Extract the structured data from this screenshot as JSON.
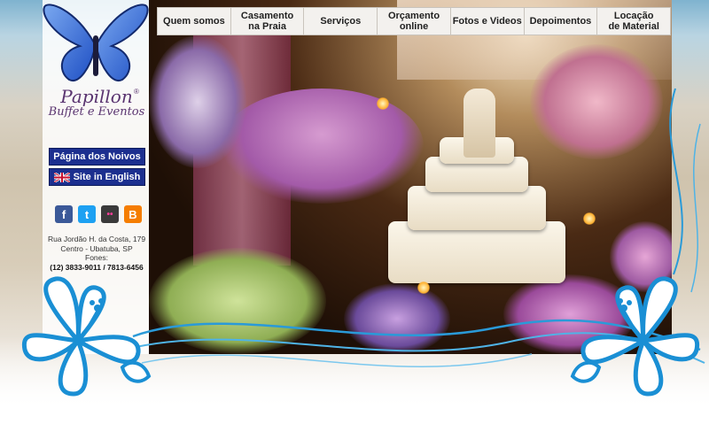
{
  "nav": {
    "items": [
      {
        "label": "Quem somos"
      },
      {
        "label": "Casamento\nna Praia"
      },
      {
        "label": "Serviços"
      },
      {
        "label": "Orçamento\nonline"
      },
      {
        "label": "Fotos e Videos"
      },
      {
        "label": "Depoimentos"
      },
      {
        "label": "Locação\nde Material"
      }
    ]
  },
  "brand": {
    "name": "Papillon",
    "subtitle": "Buffet e Eventos",
    "registered": "®"
  },
  "sidebar": {
    "noivos_label": "Página dos Noivos",
    "english_label": "Site in English",
    "social": [
      {
        "icon": "facebook-icon",
        "glyph": "f",
        "color": "#3b5998"
      },
      {
        "icon": "twitter-icon",
        "glyph": "t",
        "color": "#1da1f2"
      },
      {
        "icon": "flickr-icon",
        "glyph": "••",
        "color": "#3a3a3a"
      },
      {
        "icon": "blogger-icon",
        "glyph": "B",
        "color": "#f57d00"
      }
    ],
    "address_line1": "Rua Jordão H. da Costa, 179",
    "address_line2": "Centro - Ubatuba, SP",
    "phones_label": "Fones:",
    "phones": "(12) 3833-9011 / 7813-6456"
  },
  "colors": {
    "nav_bg": "#f3f1ee",
    "button_bg": "#1c2f8f",
    "hibiscus": "#1a8fd4",
    "brand": "#5a3470"
  }
}
